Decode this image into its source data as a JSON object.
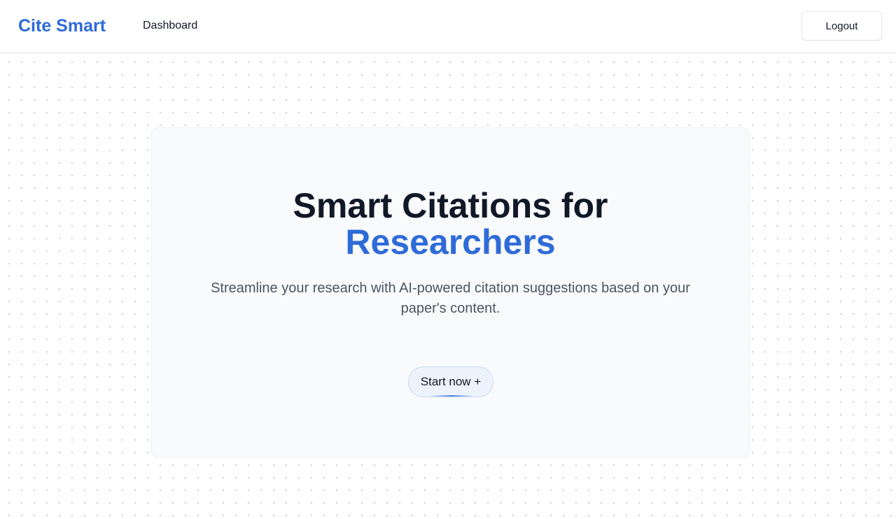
{
  "navbar": {
    "brand": "Cite Smart",
    "links": [
      {
        "label": "Dashboard"
      }
    ],
    "logout_label": "Logout"
  },
  "hero": {
    "title_line1": "Smart Citations for",
    "title_line2": "Researchers",
    "subtitle": "Streamline your research with AI-powered citation suggestions based on your paper's content.",
    "cta_label": "Start now +"
  },
  "colors": {
    "brand": "#2f6bd8",
    "text_primary": "#111827",
    "text_secondary": "#4b5563",
    "cta_background": "#edf3fc",
    "dot_grid": "#c9cdd4"
  }
}
